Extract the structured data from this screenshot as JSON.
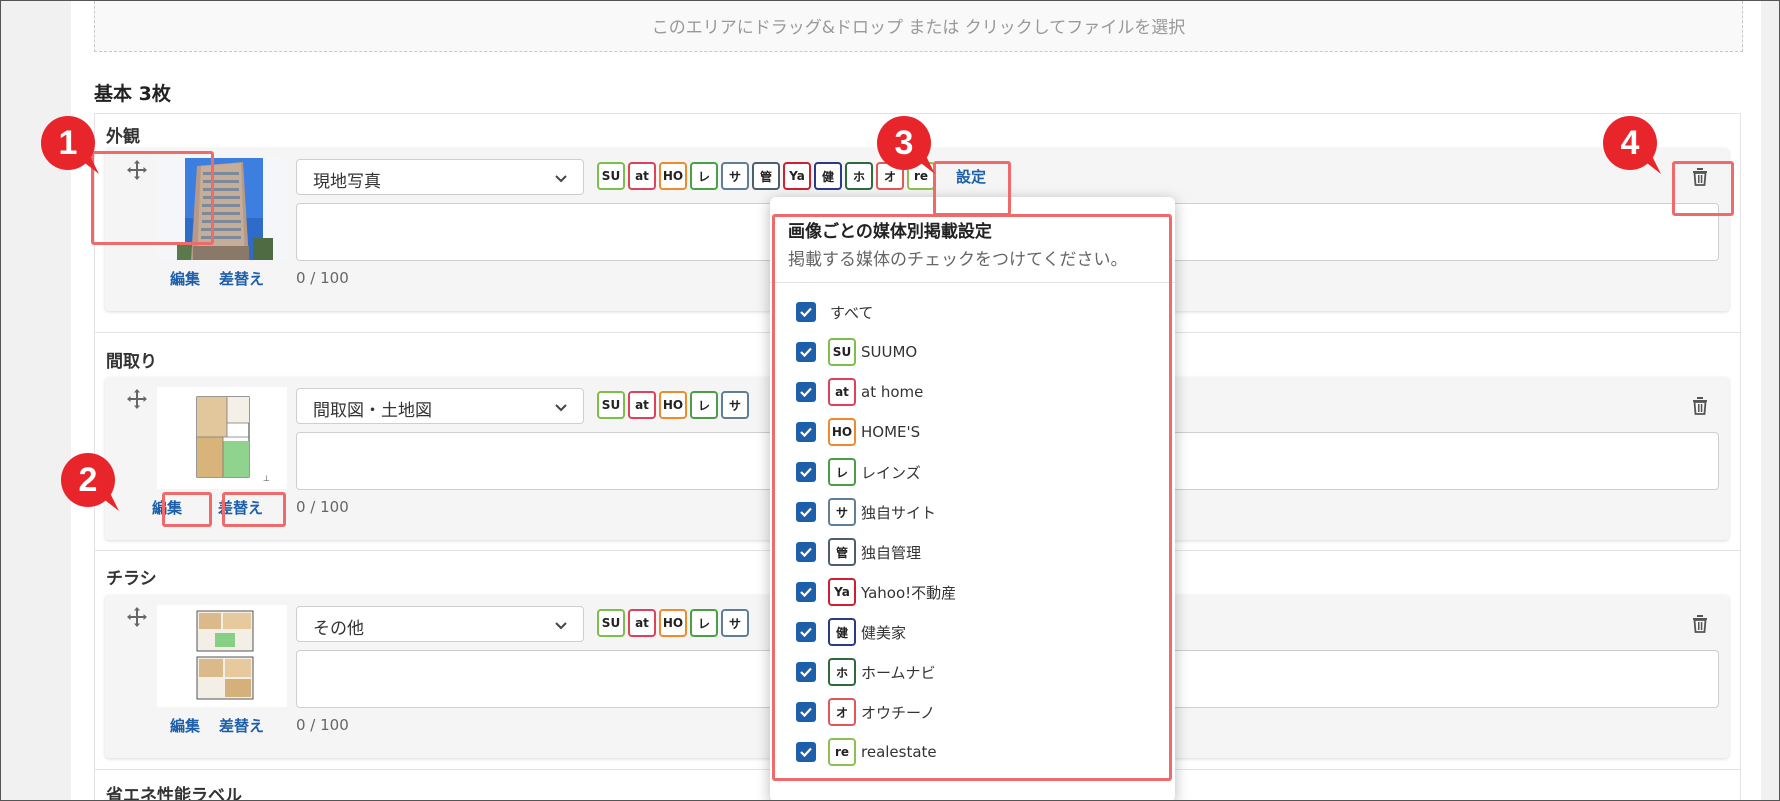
{
  "dropzone": {
    "text": "このエリアにドラッグ&ドロップ または クリックしてファイルを選択"
  },
  "section": {
    "title": "基本 3枚"
  },
  "cards": [
    {
      "group_label": "外観",
      "select_value": "現地写真",
      "edit_label": "編集",
      "replace_label": "差替え",
      "counter": "0 / 100"
    },
    {
      "group_label": "間取り",
      "select_value": "間取図・土地図",
      "edit_label": "編集",
      "replace_label": "差替え",
      "counter": "0 / 100"
    },
    {
      "group_label": "チラシ",
      "select_value": "その他",
      "edit_label": "編集",
      "replace_label": "差替え",
      "counter": "0 / 100"
    }
  ],
  "next_group_label": "省エネ性能ラベル",
  "settings_label": "設定",
  "badges": [
    {
      "code": "SU",
      "color": "#7cbf4b"
    },
    {
      "code": "at",
      "color": "#e0405a"
    },
    {
      "code": "HO",
      "color": "#f08a2c"
    },
    {
      "code": "レ",
      "color": "#4a9f46"
    },
    {
      "code": "サ",
      "color": "#5f7f98"
    },
    {
      "code": "管",
      "color": "#4d5f6e"
    },
    {
      "code": "Ya",
      "color": "#cf2031"
    },
    {
      "code": "健",
      "color": "#283a8a"
    },
    {
      "code": "ホ",
      "color": "#2f6b3a"
    },
    {
      "code": "オ",
      "color": "#e05858"
    },
    {
      "code": "re",
      "color": "#8cc152"
    }
  ],
  "popup": {
    "title": "画像ごとの媒体別掲載設定",
    "description": "掲載する媒体のチェックをつけてください。",
    "all_label": "すべて",
    "media": [
      {
        "code": "SU",
        "name": "SUUMO",
        "color": "#7cbf4b"
      },
      {
        "code": "at",
        "name": "at home",
        "color": "#e0405a"
      },
      {
        "code": "HO",
        "name": "HOME'S",
        "color": "#f08a2c"
      },
      {
        "code": "レ",
        "name": "レインズ",
        "color": "#4a9f46"
      },
      {
        "code": "サ",
        "name": "独自サイト",
        "color": "#5f7f98"
      },
      {
        "code": "管",
        "name": "独自管理",
        "color": "#4d5f6e"
      },
      {
        "code": "Ya",
        "name": "Yahoo!不動産",
        "color": "#cf2031"
      },
      {
        "code": "健",
        "name": "健美家",
        "color": "#283a8a"
      },
      {
        "code": "ホ",
        "name": "ホームナビ",
        "color": "#2f6b3a"
      },
      {
        "code": "オ",
        "name": "オウチーノ",
        "color": "#e05858"
      },
      {
        "code": "re",
        "name": "realestate",
        "color": "#8cc152"
      }
    ]
  },
  "markers": [
    "1",
    "2",
    "3",
    "4"
  ],
  "colors": {
    "accent": "#1d5fa8",
    "highlight": "#ef6b6b",
    "marker": "#e8252b"
  }
}
